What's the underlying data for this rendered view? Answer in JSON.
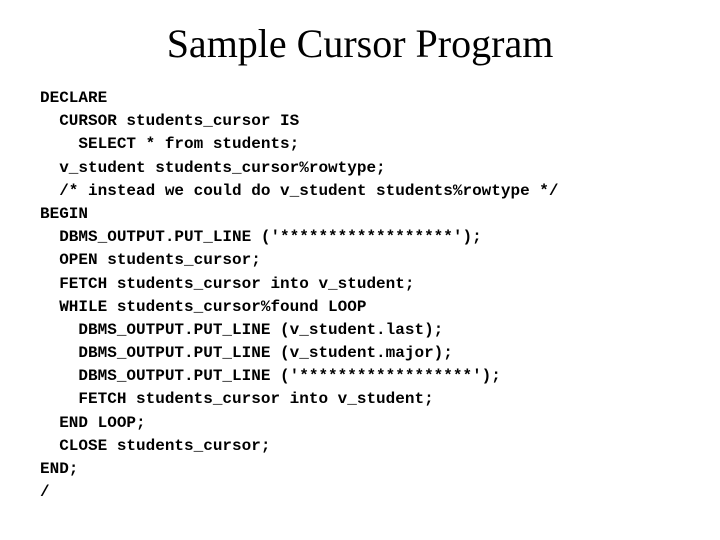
{
  "title": "Sample Cursor Program",
  "code": "DECLARE\n  CURSOR students_cursor IS\n    SELECT * from students;\n  v_student students_cursor%rowtype;\n  /* instead we could do v_student students%rowtype */\nBEGIN\n  DBMS_OUTPUT.PUT_LINE ('******************');\n  OPEN students_cursor;\n  FETCH students_cursor into v_student;\n  WHILE students_cursor%found LOOP\n    DBMS_OUTPUT.PUT_LINE (v_student.last);\n    DBMS_OUTPUT.PUT_LINE (v_student.major);\n    DBMS_OUTPUT.PUT_LINE ('******************');\n    FETCH students_cursor into v_student;\n  END LOOP;\n  CLOSE students_cursor;\nEND;\n/"
}
